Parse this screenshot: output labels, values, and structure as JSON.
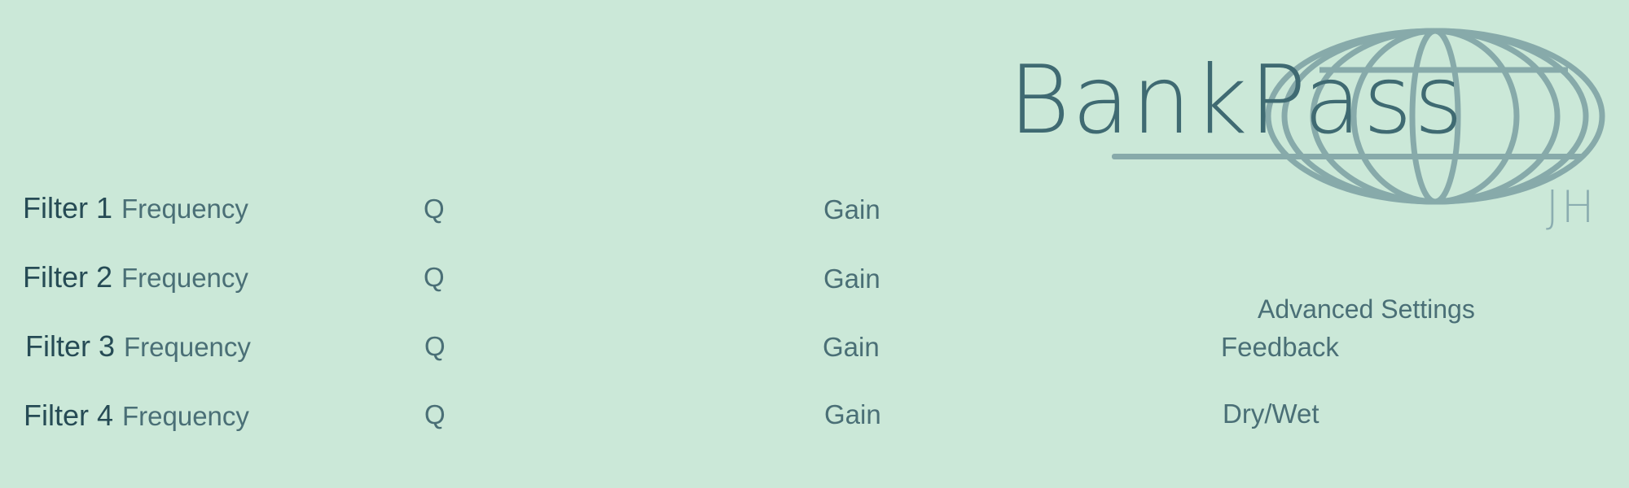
{
  "logo": {
    "title": "BankPass",
    "initials": "JH",
    "colors": {
      "title": "#3f6a72",
      "globe": "#87aaaa",
      "initials": "#8badb0"
    }
  },
  "filters": [
    {
      "label": "Filter 1",
      "frequency_label": "Frequency",
      "q_label": "Q",
      "gain_label": "Gain"
    },
    {
      "label": "Filter 2",
      "frequency_label": "Frequency",
      "q_label": "Q",
      "gain_label": "Gain"
    },
    {
      "label": "Filter 3",
      "frequency_label": "Frequency",
      "q_label": "Q",
      "gain_label": "Gain"
    },
    {
      "label": "Filter 4",
      "frequency_label": "Frequency",
      "q_label": "Q",
      "gain_label": "Gain"
    }
  ],
  "advanced": {
    "title": "Advanced Settings",
    "feedback_label": "Feedback",
    "drywet_label": "Dry/Wet"
  },
  "colors": {
    "background": "#cbe8d8",
    "text_dark": "#264b55",
    "text_medium": "#4a6f76"
  }
}
